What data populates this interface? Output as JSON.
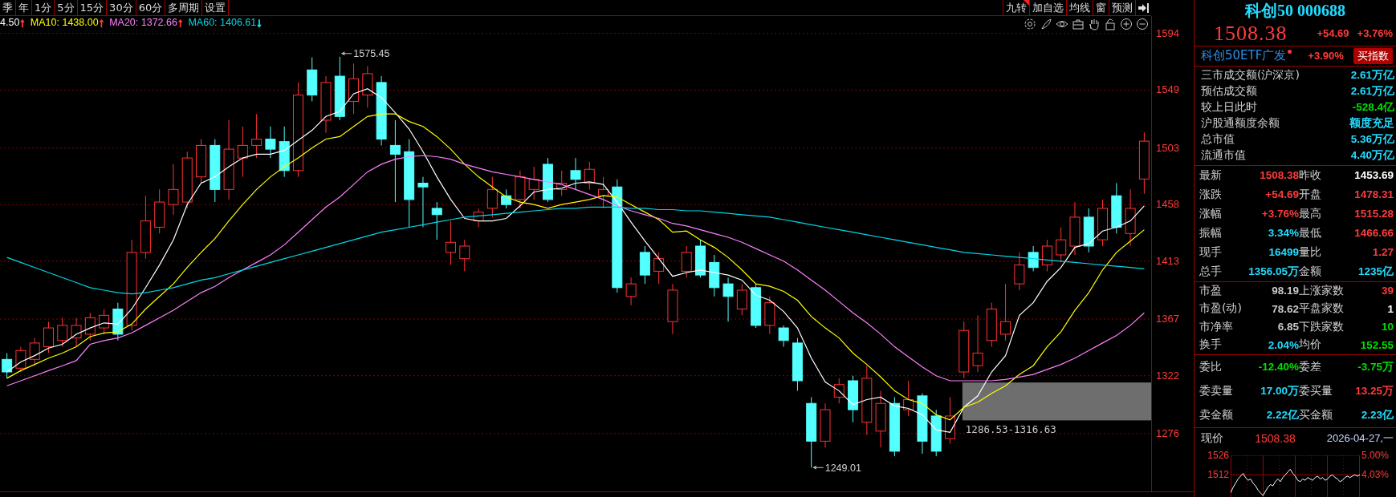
{
  "period_tabs": [
    "季",
    "年",
    "1分",
    "5分",
    "15分",
    "30分",
    "60分",
    "多周期",
    "设置"
  ],
  "tool_tabs": [
    {
      "label": "九转",
      "flag": true
    },
    {
      "label": "加自选",
      "flag": false
    },
    {
      "label": "均线",
      "flag": false
    },
    {
      "label": "窗",
      "flag": false
    },
    {
      "label": "预测",
      "flag": false
    }
  ],
  "ma_legend": [
    {
      "text": "4.50",
      "color": "#ffffff"
    },
    {
      "text": "↑",
      "color": "#ff3b3b"
    },
    {
      "text": "MA10: 1438.00",
      "color": "#ffff00"
    },
    {
      "text": "↑",
      "color": "#ff3b3b"
    },
    {
      "text": "MA20: 1372.66",
      "color": "#ff80ff"
    },
    {
      "text": "↑",
      "color": "#ff3b3b"
    },
    {
      "text": "MA60: 1406.61",
      "color": "#00d8e8"
    },
    {
      "text": "↓",
      "color": "#00e5ff"
    }
  ],
  "chart_data": {
    "type": "candlestick",
    "grid": true,
    "ylim": [
      1230.1,
      1607.8
    ],
    "categories": [
      null,
      null,
      null,
      null,
      null,
      null,
      null,
      null,
      null,
      null,
      null,
      null,
      null,
      null,
      null,
      null,
      null,
      null,
      null,
      null,
      null,
      null,
      null,
      null,
      null,
      null,
      null,
      null,
      null,
      null,
      null,
      null,
      null,
      null,
      null,
      null,
      null,
      null,
      null,
      null,
      null,
      null,
      null,
      null,
      null,
      null,
      null,
      null,
      null,
      null,
      null,
      null,
      null,
      null,
      null,
      null,
      null,
      null,
      null,
      null,
      null,
      null,
      null,
      null,
      null,
      null,
      null,
      null,
      null,
      null,
      null,
      null,
      null,
      null,
      null,
      null,
      null,
      null,
      null,
      null,
      null,
      null,
      null
    ],
    "yticks": [
      1594,
      1549,
      1503,
      1458,
      1413,
      1367,
      1322,
      1276
    ],
    "ohlc": [
      [
        1335,
        1340,
        1320,
        1325
      ],
      [
        1328,
        1345,
        1325,
        1342
      ],
      [
        1335,
        1352,
        1330,
        1348
      ],
      [
        1345,
        1365,
        1340,
        1360
      ],
      [
        1350,
        1368,
        1345,
        1362
      ],
      [
        1352,
        1368,
        1345,
        1362
      ],
      [
        1355,
        1372,
        1350,
        1368
      ],
      [
        1360,
        1375,
        1355,
        1370
      ],
      [
        1375,
        1380,
        1350,
        1355
      ],
      [
        1362,
        1430,
        1358,
        1420
      ],
      [
        1420,
        1465,
        1415,
        1445
      ],
      [
        1440,
        1470,
        1435,
        1460
      ],
      [
        1458,
        1490,
        1450,
        1470
      ],
      [
        1460,
        1500,
        1455,
        1495
      ],
      [
        1480,
        1510,
        1475,
        1505
      ],
      [
        1505,
        1510,
        1460,
        1470
      ],
      [
        1470,
        1525,
        1462,
        1502
      ],
      [
        1495,
        1520,
        1480,
        1505
      ],
      [
        1505,
        1530,
        1495,
        1510
      ],
      [
        1510,
        1520,
        1495,
        1502
      ],
      [
        1508,
        1520,
        1480,
        1485
      ],
      [
        1485,
        1555,
        1480,
        1545
      ],
      [
        1565,
        1575,
        1540,
        1545
      ],
      [
        1525,
        1560,
        1515,
        1555
      ],
      [
        1560,
        1575.45,
        1525,
        1528
      ],
      [
        1540,
        1570,
        1530,
        1558
      ],
      [
        1545,
        1568,
        1535,
        1562
      ],
      [
        1555,
        1560,
        1505,
        1510
      ],
      [
        1505,
        1525,
        1460,
        1498
      ],
      [
        1500,
        1510,
        1440,
        1462
      ],
      [
        1475,
        1480,
        1440,
        1472
      ],
      [
        1455,
        1460,
        1430,
        1450
      ],
      [
        1420,
        1445,
        1410,
        1428
      ],
      [
        1415,
        1430,
        1405,
        1425
      ],
      [
        1445,
        1455,
        1440,
        1452
      ],
      [
        1455,
        1480,
        1448,
        1470
      ],
      [
        1465,
        1470,
        1455,
        1458
      ],
      [
        1462,
        1485,
        1455,
        1480
      ],
      [
        1470,
        1488,
        1462,
        1478
      ],
      [
        1490,
        1495,
        1460,
        1462
      ],
      [
        1470,
        1485,
        1465,
        1475
      ],
      [
        1485,
        1495,
        1470,
        1478
      ],
      [
        1475,
        1492,
        1470,
        1486
      ],
      [
        1465,
        1480,
        1455,
        1470
      ],
      [
        1472,
        1478,
        1388,
        1392
      ],
      [
        1385,
        1400,
        1378,
        1395
      ],
      [
        1420,
        1425,
        1395,
        1402
      ],
      [
        1405,
        1420,
        1395,
        1415
      ],
      [
        1365,
        1395,
        1355,
        1390
      ],
      [
        1405,
        1425,
        1400,
        1420
      ],
      [
        1425,
        1430,
        1400,
        1402
      ],
      [
        1412,
        1418,
        1385,
        1392
      ],
      [
        1395,
        1400,
        1365,
        1385
      ],
      [
        1375,
        1395,
        1370,
        1390
      ],
      [
        1392,
        1395,
        1360,
        1362
      ],
      [
        1362,
        1385,
        1355,
        1380
      ],
      [
        1360,
        1362,
        1345,
        1350
      ],
      [
        1348,
        1352,
        1310,
        1318
      ],
      [
        1300,
        1305,
        1249.01,
        1270
      ],
      [
        1270,
        1300,
        1265,
        1295
      ],
      [
        1305,
        1320,
        1300,
        1315
      ],
      [
        1318,
        1322,
        1285,
        1295
      ],
      [
        1285,
        1330,
        1275,
        1320
      ],
      [
        1278,
        1310,
        1265,
        1300
      ],
      [
        1300,
        1305,
        1258,
        1262
      ],
      [
        1295,
        1318,
        1290,
        1303
      ],
      [
        1306,
        1308,
        1260,
        1270
      ],
      [
        1290,
        1295,
        1258,
        1262
      ],
      [
        1272,
        1305,
        1268,
        1290
      ],
      [
        1325,
        1365,
        1320,
        1358
      ],
      [
        1330,
        1370,
        1325,
        1340
      ],
      [
        1350,
        1380,
        1345,
        1375
      ],
      [
        1355,
        1395,
        1350,
        1365
      ],
      [
        1395,
        1420,
        1390,
        1410
      ],
      [
        1420,
        1425,
        1405,
        1408
      ],
      [
        1410,
        1430,
        1405,
        1425
      ],
      [
        1418,
        1440,
        1412,
        1430
      ],
      [
        1425,
        1460,
        1418,
        1448
      ],
      [
        1448,
        1455,
        1420,
        1425
      ],
      [
        1430,
        1462,
        1425,
        1455
      ],
      [
        1465,
        1475,
        1435,
        1440
      ],
      [
        1435,
        1470,
        1425,
        1455
      ],
      [
        1478.31,
        1515.28,
        1466.66,
        1508.38
      ]
    ],
    "series": [
      {
        "type": "line",
        "color": "#ffffff",
        "values": [
          1325,
          1333,
          1338,
          1344,
          1347,
          1355,
          1360,
          1364,
          1363,
          1375,
          1392,
          1410,
          1430,
          1458,
          1475,
          1480,
          1488,
          1495,
          1498,
          1498,
          1501,
          1509,
          1517,
          1528,
          1532,
          1546,
          1550,
          1543,
          1531,
          1518,
          1500,
          1480,
          1462,
          1447,
          1445,
          1445,
          1447,
          1457,
          1468,
          1470,
          1471,
          1475,
          1476,
          1474,
          1460,
          1444,
          1429,
          1415,
          1401,
          1404,
          1406,
          1404,
          1402,
          1398,
          1386,
          1382,
          1373,
          1360,
          1336,
          1317,
          1310,
          1299,
          1303,
          1305,
          1298,
          1296,
          1291,
          1279,
          1277,
          1297,
          1306,
          1325,
          1338,
          1370,
          1380,
          1397,
          1408,
          1424,
          1427,
          1437,
          1440,
          1445,
          1457
        ]
      },
      {
        "type": "line",
        "color": "#ffff00",
        "values": [
          1320,
          1326,
          1331,
          1336,
          1340,
          1345,
          1353,
          1356,
          1357,
          1363,
          1375,
          1385,
          1395,
          1408,
          1420,
          1431,
          1445,
          1458,
          1470,
          1480,
          1488,
          1495,
          1503,
          1510,
          1512,
          1520,
          1528,
          1530,
          1530,
          1524,
          1520,
          1512,
          1502,
          1490,
          1480,
          1472,
          1464,
          1460,
          1458,
          1455,
          1458,
          1460,
          1462,
          1465,
          1464,
          1458,
          1452,
          1446,
          1436,
          1437,
          1430,
          1424,
          1416,
          1406,
          1395,
          1393,
          1389,
          1382,
          1369,
          1360,
          1352,
          1340,
          1331,
          1321,
          1310,
          1303,
          1300,
          1291,
          1287,
          1297,
          1301,
          1308,
          1314,
          1323,
          1330,
          1345,
          1357,
          1374,
          1388,
          1406,
          1420,
          1429,
          1438
        ]
      },
      {
        "type": "line",
        "color": "#ff80ff",
        "values": [
          1314,
          1318,
          1322,
          1326,
          1330,
          1334,
          1347,
          1350,
          1352,
          1356,
          1362,
          1368,
          1374,
          1381,
          1388,
          1393,
          1400,
          1406,
          1412,
          1418,
          1426,
          1436,
          1446,
          1456,
          1464,
          1474,
          1484,
          1490,
          1494,
          1496,
          1497,
          1496,
          1494,
          1490,
          1487,
          1484,
          1482,
          1480,
          1478,
          1476,
          1474,
          1470,
          1466,
          1462,
          1457,
          1453,
          1450,
          1447,
          1443,
          1441,
          1438,
          1435,
          1432,
          1428,
          1423,
          1418,
          1413,
          1406,
          1398,
          1390,
          1381,
          1372,
          1364,
          1355,
          1345,
          1337,
          1329,
          1322,
          1318,
          1318,
          1318,
          1318,
          1319,
          1321,
          1323,
          1327,
          1331,
          1336,
          1342,
          1348,
          1354,
          1362,
          1372
        ]
      },
      {
        "type": "line",
        "color": "#00d8e8",
        "values": [
          1416,
          1412,
          1408,
          1404,
          1400,
          1396,
          1392,
          1390,
          1388,
          1387,
          1388,
          1390,
          1392,
          1395,
          1398,
          1400,
          1403,
          1406,
          1409,
          1412,
          1415,
          1418,
          1421,
          1424,
          1427,
          1430,
          1433,
          1436,
          1438,
          1440,
          1442,
          1444,
          1446,
          1448,
          1449,
          1450,
          1451,
          1452,
          1453,
          1454,
          1455,
          1455,
          1456,
          1456,
          1456,
          1455,
          1455,
          1454,
          1454,
          1453,
          1453,
          1452,
          1451,
          1450,
          1449,
          1448,
          1446,
          1444,
          1442,
          1440,
          1438,
          1436,
          1434,
          1432,
          1430,
          1428,
          1426,
          1424,
          1422,
          1420,
          1419,
          1418,
          1417,
          1416,
          1415,
          1414,
          1413,
          1412,
          1411,
          1410,
          1409,
          1408,
          1407
        ]
      }
    ],
    "annotations": [
      "1575.45",
      "1249.01",
      "1286.53-1316.63"
    ]
  },
  "panel": {
    "title": "科创50 000688",
    "price": "1508.38",
    "change": "+54.69",
    "change_pct": "+3.76%",
    "etf": {
      "name": "科创50ETF广发",
      "change": "+3.90%",
      "button": "买指数"
    },
    "market_rows": [
      {
        "label": "三市成交额(沪深京)",
        "value": "2.61万亿",
        "color": "#22dcff"
      },
      {
        "label": "预估成交额",
        "value": "2.61万亿",
        "color": "#22dcff"
      },
      {
        "label": "较上日此时",
        "value": "-528.4亿",
        "color": "#00e000"
      },
      {
        "label": "沪股通额度余额",
        "value": "额度充足",
        "color": "#22dcff"
      },
      {
        "label": "总市值",
        "value": "5.36万亿",
        "color": "#22dcff"
      },
      {
        "label": "流通市值",
        "value": "4.40万亿",
        "color": "#22dcff"
      }
    ],
    "quote_groups": [
      [
        {
          "label": "最新",
          "value": "1508.38",
          "color": "#ff3b3b"
        },
        {
          "label": "昨收",
          "value": "1453.69",
          "color": "#ffffff"
        },
        {
          "label": "涨跌",
          "value": "+54.69",
          "color": "#ff3b3b"
        },
        {
          "label": "开盘",
          "value": "1478.31",
          "color": "#ff3b3b"
        },
        {
          "label": "涨幅",
          "value": "+3.76%",
          "color": "#ff3b3b"
        },
        {
          "label": "最高",
          "value": "1515.28",
          "color": "#ff3b3b"
        },
        {
          "label": "振幅",
          "value": "3.34%",
          "color": "#22dcff"
        },
        {
          "label": "最低",
          "value": "1466.66",
          "color": "#ff3b3b"
        },
        {
          "label": "现手",
          "value": "16499",
          "color": "#22dcff"
        },
        {
          "label": "量比",
          "value": "1.27",
          "color": "#ff3b3b"
        },
        {
          "label": "总手",
          "value": "1356.05万",
          "color": "#22dcff"
        },
        {
          "label": "金额",
          "value": "1235亿",
          "color": "#22dcff"
        }
      ],
      [
        {
          "label": "市盈",
          "value": "98.19",
          "color": "#c8c8c8"
        },
        {
          "label": "上涨家数",
          "value": "39",
          "color": "#ff3b3b"
        },
        {
          "label": "市盈(动)",
          "value": "78.62",
          "color": "#c8c8c8"
        },
        {
          "label": "平盘家数",
          "value": "1",
          "color": "#ffffff"
        },
        {
          "label": "市净率",
          "value": "6.85",
          "color": "#c8c8c8"
        },
        {
          "label": "下跌家数",
          "value": "10",
          "color": "#00e000"
        },
        {
          "label": "换手",
          "value": "2.04%",
          "color": "#22dcff"
        },
        {
          "label": "均价",
          "value": "152.55",
          "color": "#00e000"
        }
      ],
      [
        {
          "label": "委比",
          "value": "-12.40%",
          "color": "#00e000"
        },
        {
          "label": "委差",
          "value": "-3.75万",
          "color": "#00e000"
        },
        {
          "label": "委卖量",
          "value": "17.00万",
          "color": "#22dcff"
        },
        {
          "label": "委买量",
          "value": "13.25万",
          "color": "#ff3b3b"
        },
        {
          "label": "卖金额",
          "value": "2.22亿",
          "color": "#22dcff"
        },
        {
          "label": "买金额",
          "value": "2.23亿",
          "color": "#22dcff"
        }
      ]
    ],
    "now": {
      "label": "现价",
      "value": "1508.38",
      "date": "2026-04-27,一"
    },
    "mini_chart": {
      "chart_data": {
        "type": "line",
        "grid": true,
        "ylim": [
          1496,
          1526
        ],
        "y2lim": [
          2.92,
          5.0
        ],
        "yticks": [
          1526,
          1512
        ],
        "y2ticks": [
          {
            "value": 5.0,
            "label": "5.00%"
          },
          {
            "value": 4.03,
            "label": "4.03%"
          }
        ],
        "series": [
          {
            "color": "#ffffff",
            "values": [
              1499,
              1503,
              1506,
              1509,
              1511,
              1513,
              1510,
              1508,
              1509,
              1506,
              1504,
              1501,
              1499,
              1497,
              1500,
              1503,
              1505,
              1504,
              1507,
              1509,
              1507,
              1510,
              1512,
              1514,
              1516,
              1513,
              1511,
              1508,
              1507,
              1509,
              1508,
              1510,
              1509,
              1508,
              1510,
              1511,
              1509,
              1510,
              1508,
              1509,
              1511,
              1512,
              1510,
              1509,
              1507,
              1508,
              1510,
              1511,
              1510,
              1511,
              1512,
              1511,
              1512
            ]
          }
        ]
      }
    }
  }
}
